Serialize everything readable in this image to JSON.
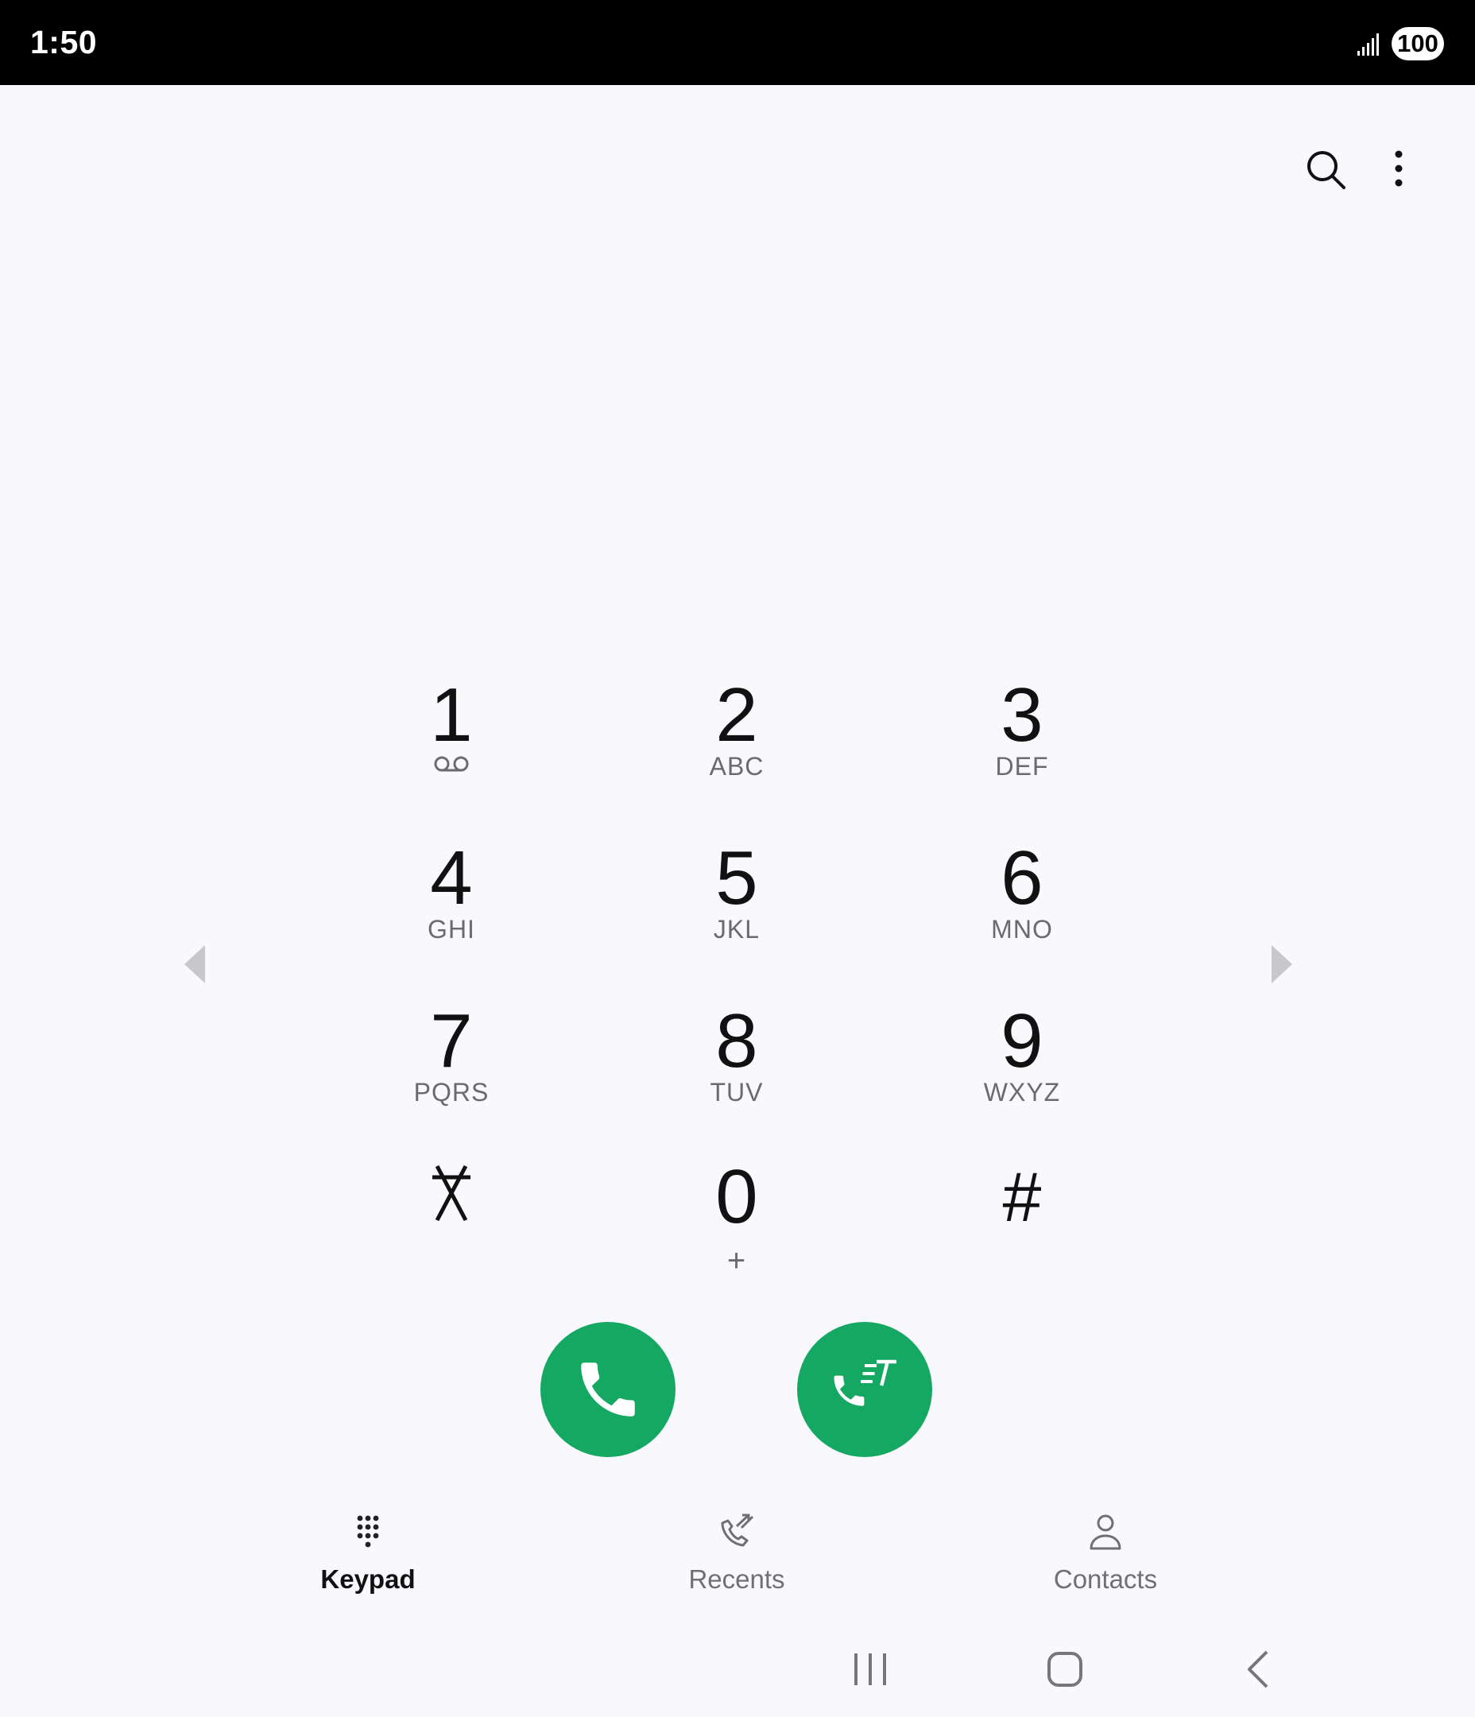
{
  "status_bar": {
    "time": "1:50",
    "battery": "100",
    "signal_icon": "signal-bars-icon"
  },
  "toolbar": {
    "search_icon": "search-icon",
    "more_icon": "more-vertical-icon"
  },
  "keypad": {
    "keys": [
      {
        "digit": "1",
        "letters": ""
      },
      {
        "digit": "2",
        "letters": "ABC"
      },
      {
        "digit": "3",
        "letters": "DEF"
      },
      {
        "digit": "4",
        "letters": "GHI"
      },
      {
        "digit": "5",
        "letters": "JKL"
      },
      {
        "digit": "6",
        "letters": "MNO"
      },
      {
        "digit": "7",
        "letters": "PQRS"
      },
      {
        "digit": "8",
        "letters": "TUV"
      },
      {
        "digit": "9",
        "letters": "WXYZ"
      },
      {
        "digit": "⁎",
        "letters": ""
      },
      {
        "digit": "0",
        "letters": "+"
      },
      {
        "digit": "#",
        "letters": ""
      }
    ]
  },
  "actions": {
    "call_icon": "phone-icon",
    "rtt_call_icon": "rtt-call-icon",
    "accent_color": "#14a862"
  },
  "tabs": [
    {
      "label": "Keypad",
      "icon": "keypad-icon",
      "active": true
    },
    {
      "label": "Recents",
      "icon": "recents-icon",
      "active": false
    },
    {
      "label": "Contacts",
      "icon": "contacts-icon",
      "active": false
    }
  ]
}
